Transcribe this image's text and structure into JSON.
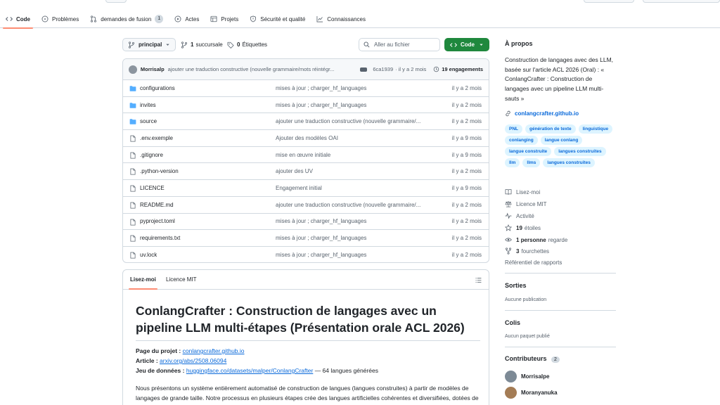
{
  "nav": {
    "tabs": [
      {
        "label": "Code",
        "icon": "code-icon"
      },
      {
        "label": "Problèmes",
        "icon": "issue-icon"
      },
      {
        "label": "demandes de fusion",
        "icon": "pull-request-icon",
        "count": "1"
      },
      {
        "label": "Actes",
        "icon": "play-icon"
      },
      {
        "label": "Projets",
        "icon": "table-icon"
      },
      {
        "label": "Sécurité et qualité",
        "icon": "shield-icon"
      },
      {
        "label": "Connaissances",
        "icon": "graph-icon"
      }
    ]
  },
  "toolbar": {
    "branch": "principal",
    "branches_count": "1",
    "branches_label": "succursale",
    "tags_count": "0",
    "tags_label": "Étiquettes",
    "search_placeholder": "Aller au fichier",
    "code_button": "Code"
  },
  "commit": {
    "author": "Morrisalp",
    "message": "ajouter une traduction constructive (nouvelle grammaire/mots réintégr...",
    "hash": "6ca1939",
    "time": "· il y a 2 mois",
    "count": "19 engagements"
  },
  "files": [
    {
      "name": "configurations",
      "type": "folder",
      "message": "mises à jour ; charger_hf_languages",
      "date": "il y a 2 mois"
    },
    {
      "name": "invites",
      "type": "folder",
      "message": "mises à jour ; charger_hf_languages",
      "date": "il y a 2 mois"
    },
    {
      "name": "source",
      "type": "folder",
      "message": "ajouter une traduction constructive (nouvelle grammaire/...",
      "date": "il y a 2 mois"
    },
    {
      "name": ".env.exemple",
      "type": "file",
      "message": "Ajouter des modèles OAI",
      "date": "il y a 9 mois"
    },
    {
      "name": ".gitignore",
      "type": "file",
      "message": "mise en œuvre initiale",
      "date": "il y a 9 mois"
    },
    {
      "name": ".python-version",
      "type": "file",
      "message": "ajouter des UV",
      "date": "il y a 2 mois"
    },
    {
      "name": "LICENCE",
      "type": "file",
      "message": "Engagement initial",
      "date": "il y a 9 mois"
    },
    {
      "name": "README.md",
      "type": "file",
      "message": "ajouter une traduction constructive (nouvelle grammaire/...",
      "date": "il y a 2 mois"
    },
    {
      "name": "pyproject.toml",
      "type": "file",
      "message": "mises à jour ; charger_hf_languages",
      "date": "il y a 2 mois"
    },
    {
      "name": "requirements.txt",
      "type": "file",
      "message": "mises à jour ; charger_hf_languages",
      "date": "il y a 2 mois"
    },
    {
      "name": "uv.lock",
      "type": "file",
      "message": "mises à jour ; charger_hf_languages",
      "date": "il y a 2 mois"
    }
  ],
  "readme": {
    "tab_readme": "Lisez-moi",
    "tab_license": "Licence MIT",
    "title": "ConlangCrafter : Construction de langages avec un pipeline LLM multi-étapes (Présentation orale ACL 2026)",
    "project_label": "Page du projet :",
    "project_link": "conlangcrafter.github.io",
    "article_label": "Article :",
    "article_link": "arxiv.org/abs/2508.06094",
    "dataset_label": "Jeu de données :",
    "dataset_link": "huggingface.co/datasets/malper/ConlangCrafter",
    "dataset_suffix": "— 64 langues générées",
    "paragraph": "Nous présentons un système entièrement automatisé de construction de langues (langues construites) à partir de modèles de langages de grande taille. Notre processus en plusieurs étapes crée des langues artificielles cohérentes et diversifiées, dotées de leur propre phonologie, grammaire, lexique et capacités de traduction."
  },
  "sidebar": {
    "about_title": "À propos",
    "description": "Construction de langages avec des LLM, basée sur l'article ACL 2026 (Oral) : « ConlangCrafter : Construction de langages avec un pipeline LLM multi-sauts »",
    "website": "conlangcrafter.github.io",
    "topics": [
      "PNL",
      "génération de texte",
      "linguistique",
      "conlanging",
      "langue conlang",
      "langue construite",
      "langues construites",
      "llm",
      "llms",
      "langues construites"
    ],
    "readme_link": "Lisez-moi",
    "license_link": "Licence MIT",
    "activity_link": "Activité",
    "stars_count": "19",
    "stars_label": "étoiles",
    "watchers_count": "1 personne",
    "watchers_label": "regarde",
    "forks_count": "3",
    "forks_label": "fourchettes",
    "report_link": "Référentiel de rapports",
    "releases_title": "Sorties",
    "releases_empty": "Aucune publication",
    "packages_title": "Colis",
    "packages_empty": "Aucun paquet publié",
    "contributors_title": "Contributeurs",
    "contributors_count": "2",
    "contributors": [
      "Morrisalpe",
      "Moranyanuka"
    ]
  }
}
